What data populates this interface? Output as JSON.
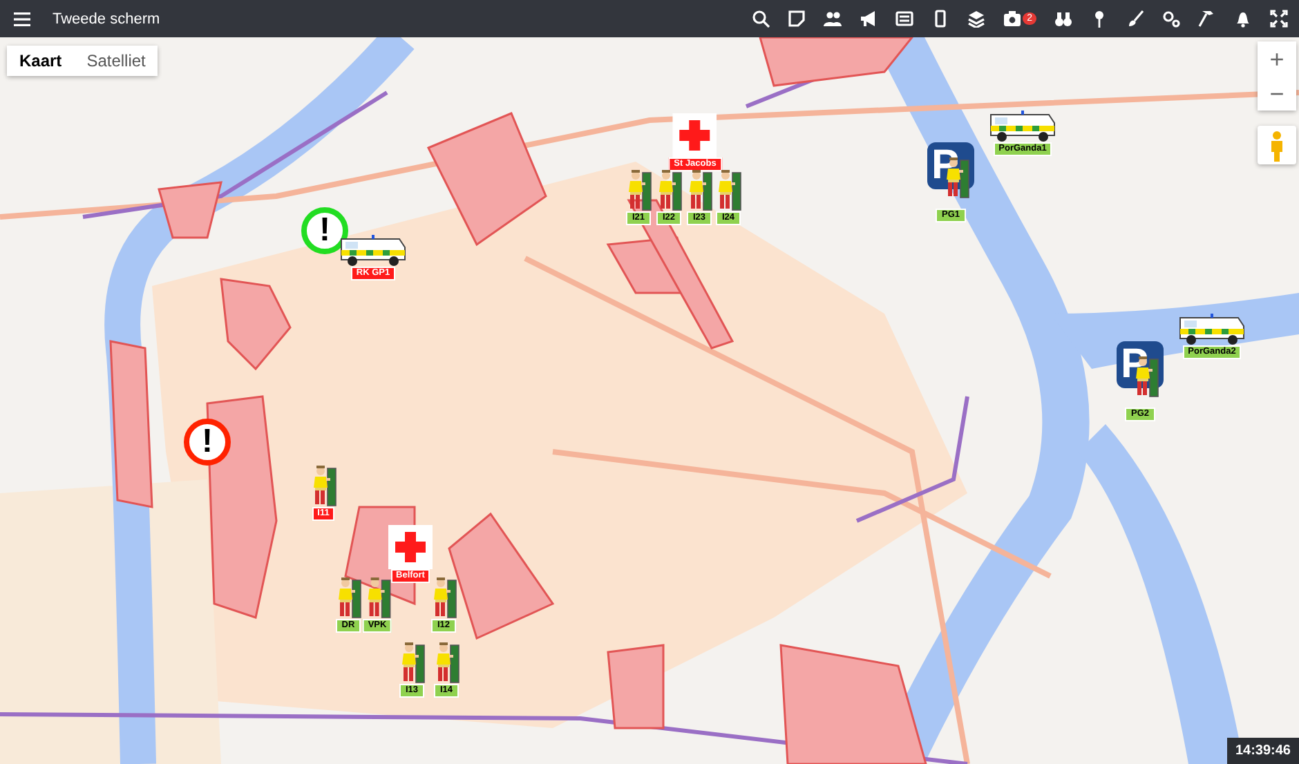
{
  "window": {
    "title": "Tweede scherm"
  },
  "toolbar": {
    "camera_badge": "2"
  },
  "map_type": [
    {
      "label": "Kaart",
      "selected": true
    },
    {
      "label": "Satelliet",
      "selected": false
    }
  ],
  "zoom": {
    "in": "+",
    "out": "−"
  },
  "markers": [
    {
      "kind": "station",
      "label": "St Jacobs",
      "color": "#ff1a1a"
    },
    {
      "kind": "post",
      "label": "I21",
      "color": "#8fd14f"
    },
    {
      "kind": "post",
      "label": "I22",
      "color": "#8fd14f"
    },
    {
      "kind": "post",
      "label": "I23",
      "color": "#8fd14f"
    },
    {
      "kind": "post",
      "label": "I24",
      "color": "#8fd14f"
    },
    {
      "kind": "parking",
      "sign": "P",
      "label": "PG1",
      "color": "#8fd14f"
    },
    {
      "kind": "van",
      "label": "PorGanda1",
      "color": "#8fd14f"
    },
    {
      "kind": "van",
      "label": "PorGanda2",
      "color": "#8fd14f"
    },
    {
      "kind": "parking",
      "sign": "P",
      "label": "PG2",
      "color": "#8fd14f"
    },
    {
      "kind": "alert",
      "symbol": "!",
      "color": "#22dd22"
    },
    {
      "kind": "van",
      "label": "RK GP1",
      "color": "#ff1a1a"
    },
    {
      "kind": "alert",
      "symbol": "!",
      "color": "#ff2200"
    },
    {
      "kind": "post",
      "label": "I11",
      "color": "#ff1a1a"
    },
    {
      "kind": "station",
      "label": "Belfort",
      "color": "#ff1a1a"
    },
    {
      "kind": "post",
      "label": "DR",
      "color": "#8fd14f"
    },
    {
      "kind": "post",
      "label": "VPK",
      "color": "#8fd14f"
    },
    {
      "kind": "post",
      "label": "I12",
      "color": "#8fd14f"
    },
    {
      "kind": "post",
      "label": "I13",
      "color": "#8fd14f"
    },
    {
      "kind": "post",
      "label": "I14",
      "color": "#8fd14f"
    }
  ],
  "clock": "14:39:46"
}
